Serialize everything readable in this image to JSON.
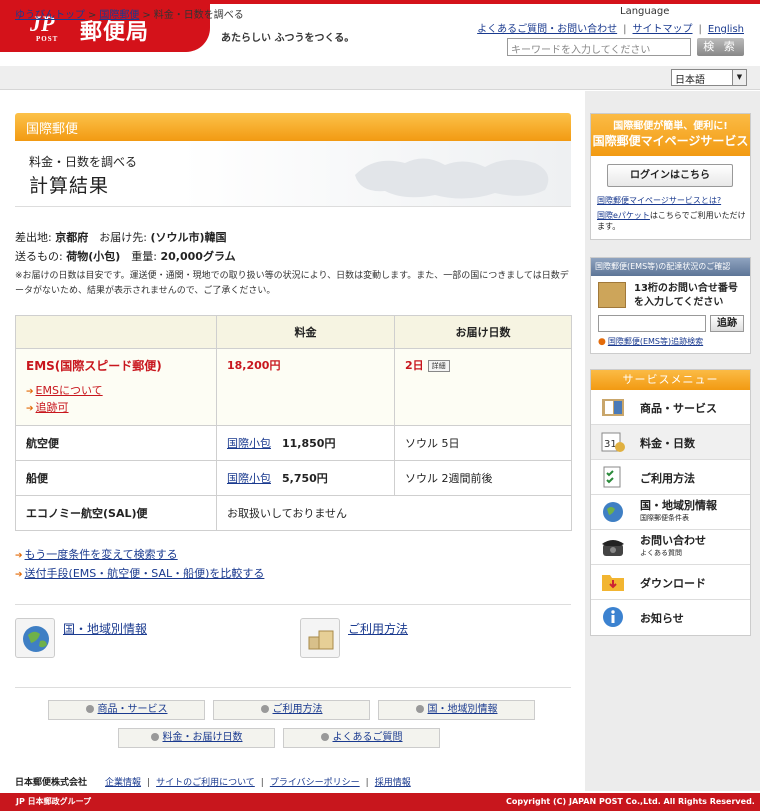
{
  "header": {
    "logo_mark": "JP",
    "logo_post": "POST",
    "logo_name": "郵便局",
    "tagline": "あたらしい ふつうをつくる。",
    "links": [
      "よくあるご質問・お問い合わせ",
      "サイトマップ",
      "English"
    ],
    "search_placeholder": "キーワードを入力してください",
    "search_button": "検 索"
  },
  "breadcrumb": [
    "ゆうびんトップ",
    "国際郵便",
    "料金・日数を調べる"
  ],
  "language": {
    "label": "Language",
    "selected": "日本語"
  },
  "section": "国際郵便",
  "page": {
    "subtitle": "料金・日数を調べる",
    "title": "計算結果"
  },
  "info": {
    "origin_label": "差出地:",
    "origin": "京都府",
    "dest_label": "お届け先:",
    "dest": "(ソウル市)韓国",
    "item_label": "送るもの:",
    "item": "荷物(小包)",
    "weight_label": "重量:",
    "weight": "20,000グラム",
    "note": "※お届けの日数は目安です。運送便・通関・現地での取り扱い等の状況により、日数は変動します。また、一部の国につきましては日数データがないため、結果が表示されませんので、ご了承ください。"
  },
  "table": {
    "headers": [
      "",
      "料金",
      "お届け日数"
    ],
    "ems": {
      "name": "EMS(国際スピード郵便)",
      "link1": "EMSについて",
      "link2": "追跡可",
      "price": "18,200円",
      "days": "2日",
      "detail": "詳細"
    },
    "air": {
      "name": "航空便",
      "link": "国際小包",
      "price": "11,850円",
      "days": "ソウル 5日"
    },
    "ship": {
      "name": "船便",
      "link": "国際小包",
      "price": "5,750円",
      "days": "ソウル 2週間前後"
    },
    "sal": {
      "name": "エコノミー航空(SAL)便",
      "value": "お取扱いしておりません"
    }
  },
  "actions": [
    "もう一度条件を変えて検索する",
    "送付手段(EMS・航空便・SAL・船便)を比較する"
  ],
  "features": [
    "国・地域別情報",
    "ご利用方法"
  ],
  "nav": [
    "商品・サービス",
    "ご利用方法",
    "国・地域別情報",
    "料金・お届け日数",
    "よくあるご質問"
  ],
  "footer": {
    "company": "日本郵便株式会社",
    "links": [
      "企業情報",
      "サイトのご利用について",
      "プライバシーポリシー",
      "採用情報"
    ],
    "group": "日本郵政グループ",
    "copyright": "Copyright (C) JAPAN POST Co.,Ltd.  All Rights Reserved."
  },
  "mypage": {
    "line1": "国際郵便が簡単、便利に!",
    "line2": "国際郵便マイページサービス",
    "login": "ログインはこちら",
    "link1": "国際郵便マイページサービスとは?",
    "link2": "国際eパケット",
    "link2_rest": "はこちらでご利用いただけます。"
  },
  "track": {
    "header": "国際郵便(EMS等)の配達状況のご確認",
    "text1": "13桁のお問い合せ番号",
    "text2": "を入力してください",
    "button": "追跡",
    "link": "国際郵便(EMS等)追跡検索"
  },
  "services": {
    "header": "サービスメニュー",
    "items": [
      {
        "name": "商品・サービス"
      },
      {
        "name": "料金・日数"
      },
      {
        "name": "ご利用方法"
      },
      {
        "name": "国・地域別情報",
        "sub": "国際郵便条件表"
      },
      {
        "name": "お問い合わせ",
        "sub": "よくある質問"
      },
      {
        "name": "ダウンロード"
      },
      {
        "name": "お知らせ"
      }
    ]
  },
  "colors": {
    "brand_red": "#d4121a",
    "orange": "#f29a12",
    "link": "#1a3a8f"
  }
}
